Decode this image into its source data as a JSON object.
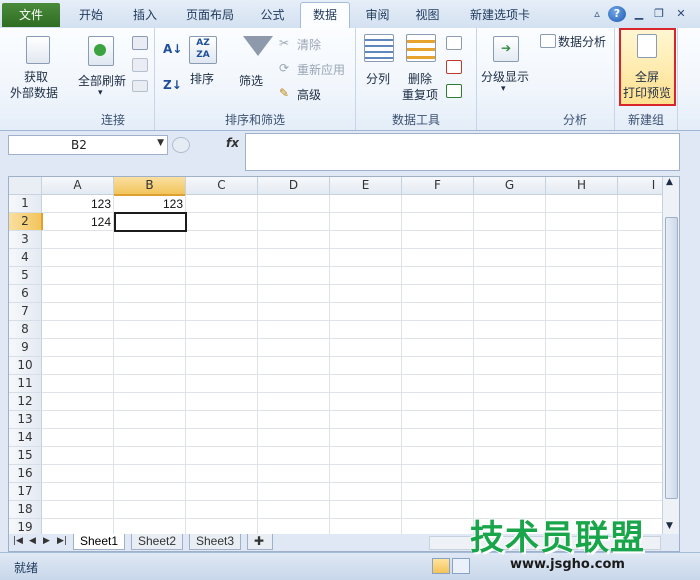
{
  "tabs": [
    "文件",
    "开始",
    "插入",
    "页面布局",
    "公式",
    "数据",
    "审阅",
    "视图",
    "新建选项卡"
  ],
  "ribbon": {
    "get_data": [
      "获取",
      "外部数据"
    ],
    "refresh_all": "全部刷新",
    "group_connections": "连接",
    "sort_label": "排序",
    "filter_label": "筛选",
    "clear_label": "清除",
    "reapply_label": "重新应用",
    "advanced_label": "高级",
    "group_sort_filter": "排序和筛选",
    "split_label": "分列",
    "remove_dup": [
      "删除",
      "重复项"
    ],
    "group_data_tools": "数据工具",
    "outline_label": "分级显示",
    "data_analysis": "数据分析",
    "group_analysis": "分析",
    "print_preview": [
      "全屏",
      "打印预览"
    ],
    "group_new": "新建组"
  },
  "formula_bar": {
    "name_box": "B2",
    "fx": "fx",
    "formula": ""
  },
  "columns": [
    "A",
    "B",
    "C",
    "D",
    "E",
    "F",
    "G",
    "H",
    "I"
  ],
  "rows": [
    "1",
    "2",
    "3",
    "4",
    "5",
    "6",
    "7",
    "8",
    "9",
    "10",
    "11",
    "12",
    "13",
    "14",
    "15",
    "16",
    "17",
    "18",
    "19"
  ],
  "cells": {
    "A1": "123",
    "B1": "123",
    "A2": "124"
  },
  "sheets": [
    "Sheet1",
    "Sheet2",
    "Sheet3"
  ],
  "status": {
    "ready": "就绪"
  },
  "watermark": {
    "text": "技术员联盟",
    "url": "www.jsgho.com"
  }
}
